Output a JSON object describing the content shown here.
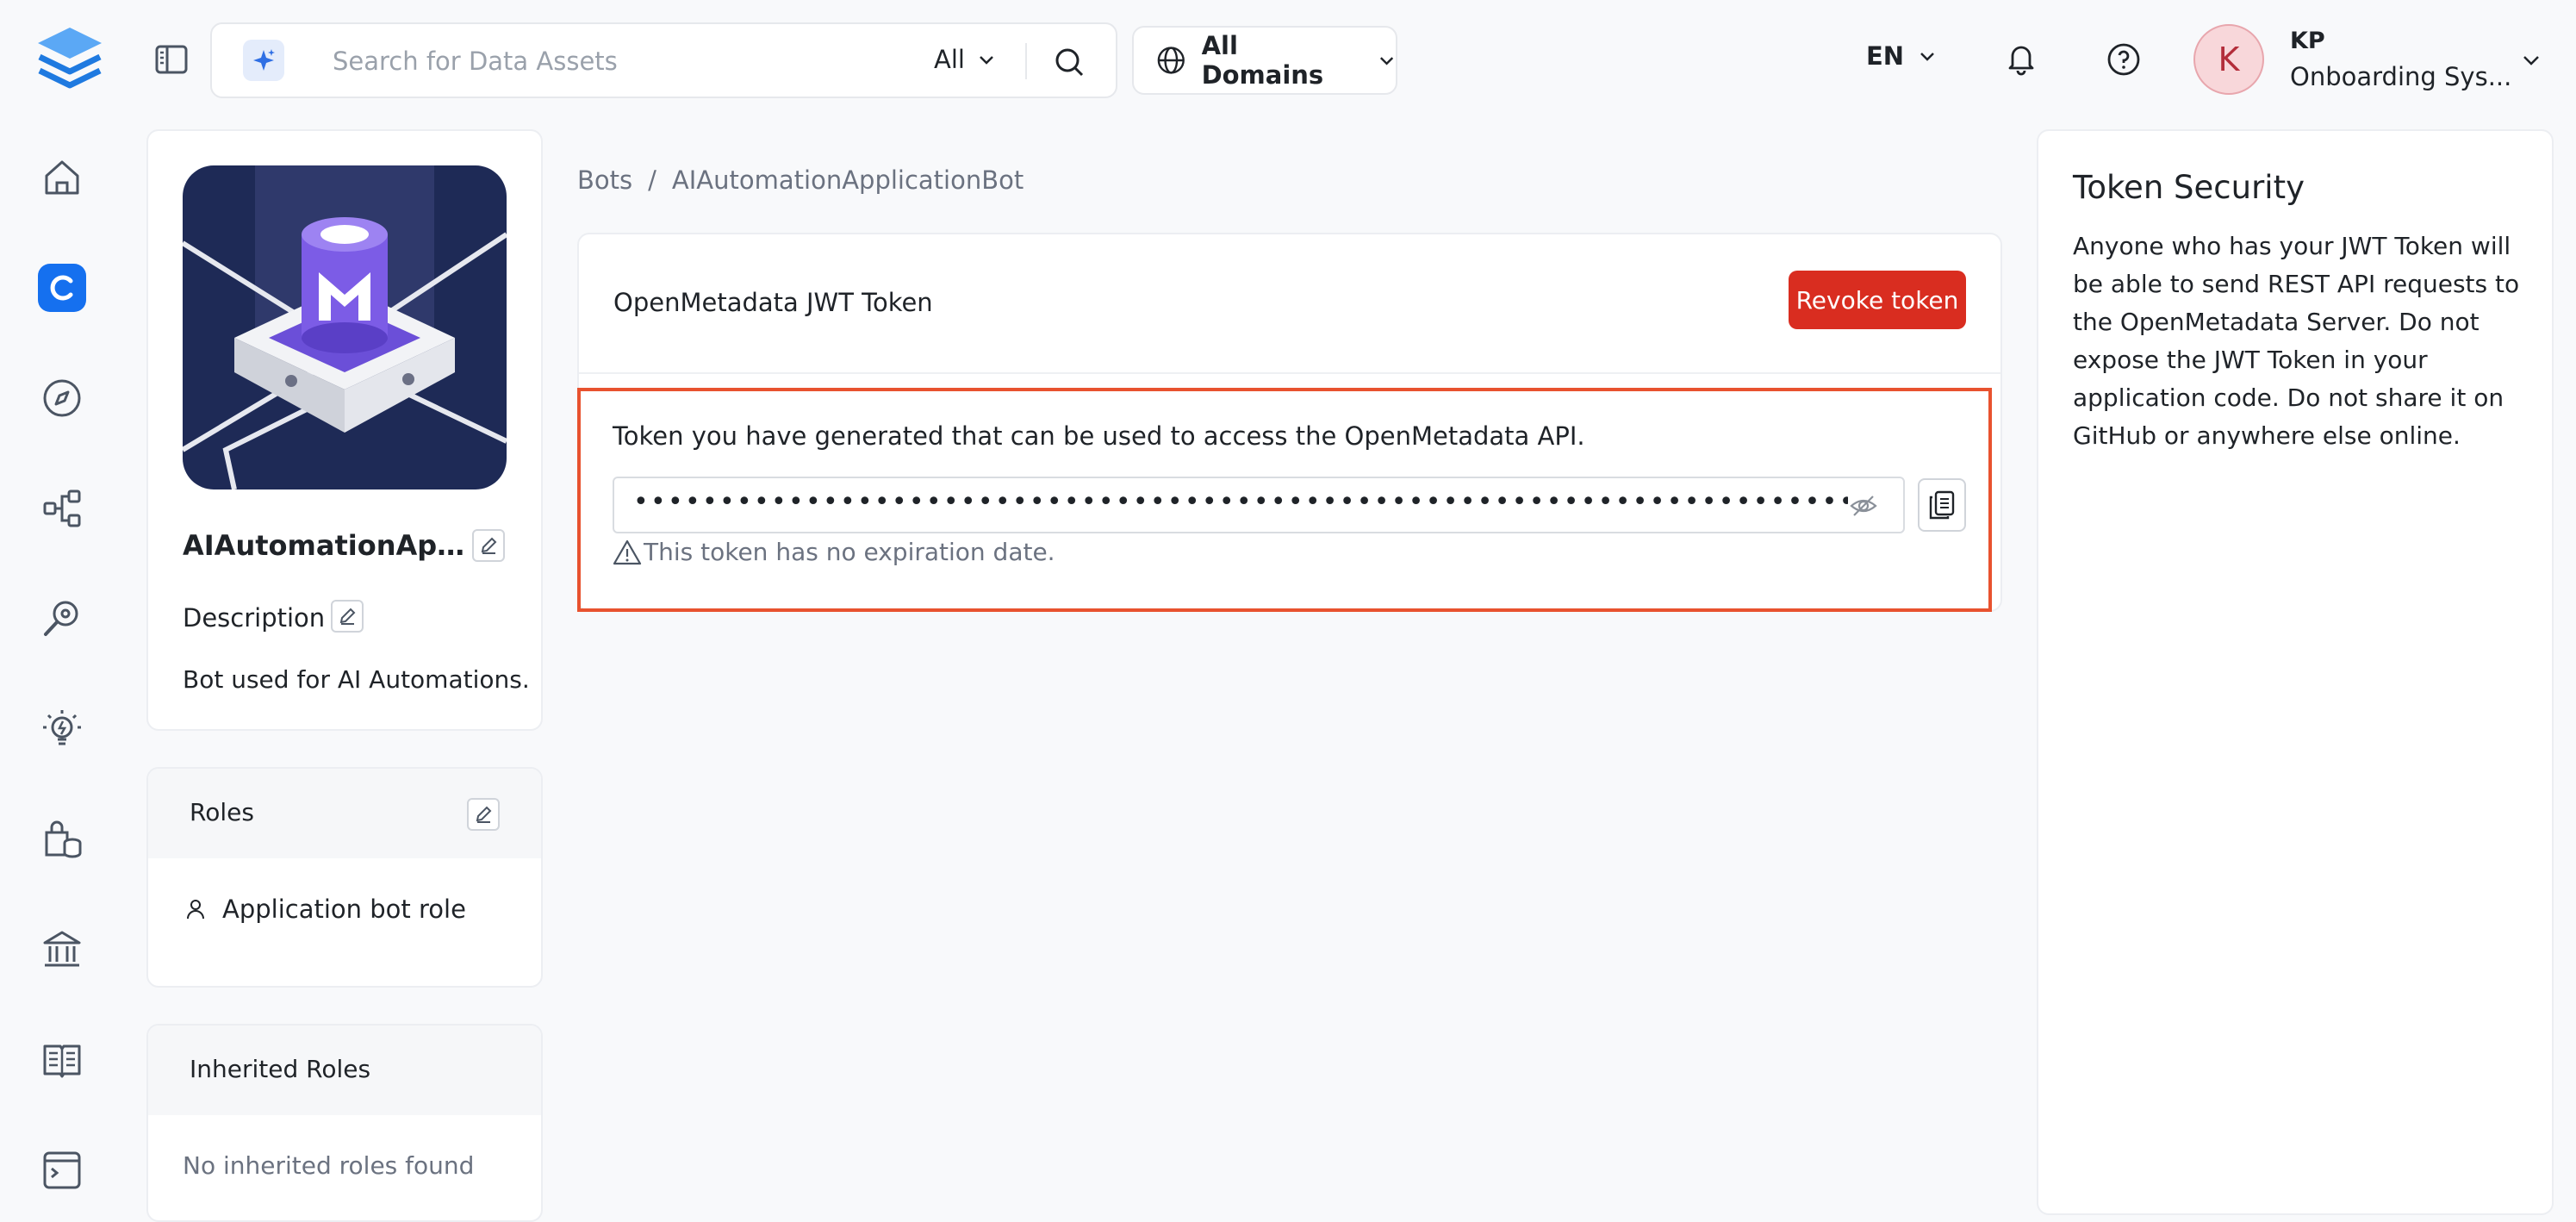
{
  "header": {
    "search_placeholder": "Search for Data Assets",
    "search_scope": "All",
    "domains_label": "All Domains",
    "language": "EN",
    "user": {
      "initial": "K",
      "name": "KP",
      "role": "Onboarding Sys..."
    }
  },
  "nav": {
    "items": [
      "home-icon",
      "explore-icon",
      "compass-icon",
      "lineage-icon",
      "observability-icon",
      "insights-icon",
      "data-products-icon",
      "governance-icon",
      "glossary-icon",
      "terminal-icon"
    ],
    "active": "explore-icon"
  },
  "profile": {
    "name": "AIAutomationAppl...",
    "description_label": "Description",
    "description": "Bot used for AI Automations."
  },
  "roles": {
    "title": "Roles",
    "items": [
      "Application bot role"
    ]
  },
  "inherited_roles": {
    "title": "Inherited Roles",
    "empty_text": "No inherited roles found"
  },
  "breadcrumb": {
    "root": "Bots",
    "separator": "/",
    "current": "AIAutomationApplicationBot"
  },
  "token": {
    "title": "OpenMetadata JWT Token",
    "revoke_label": "Revoke token",
    "description": "Token you have generated that can be used to access the OpenMetadata API.",
    "masked_value": "•••••••••••••••••••••••••••••••••••••••••••••••••••••••••••••••••••••••••••••••••••••••••••••••••••••••••••••••••••••••••••••",
    "expiry_text": "This token has no expiration date."
  },
  "security": {
    "title": "Token Security",
    "text": "Anyone who has your JWT Token will be able to send REST API requests to the OpenMetadata Server. Do not expose the JWT Token in your application code. Do not share it on GitHub or anywhere else online."
  },
  "colors": {
    "primary": "#1570ef",
    "danger": "#d92d20",
    "highlight": "#e8522f",
    "avatar_bg": "#f8d7da"
  }
}
